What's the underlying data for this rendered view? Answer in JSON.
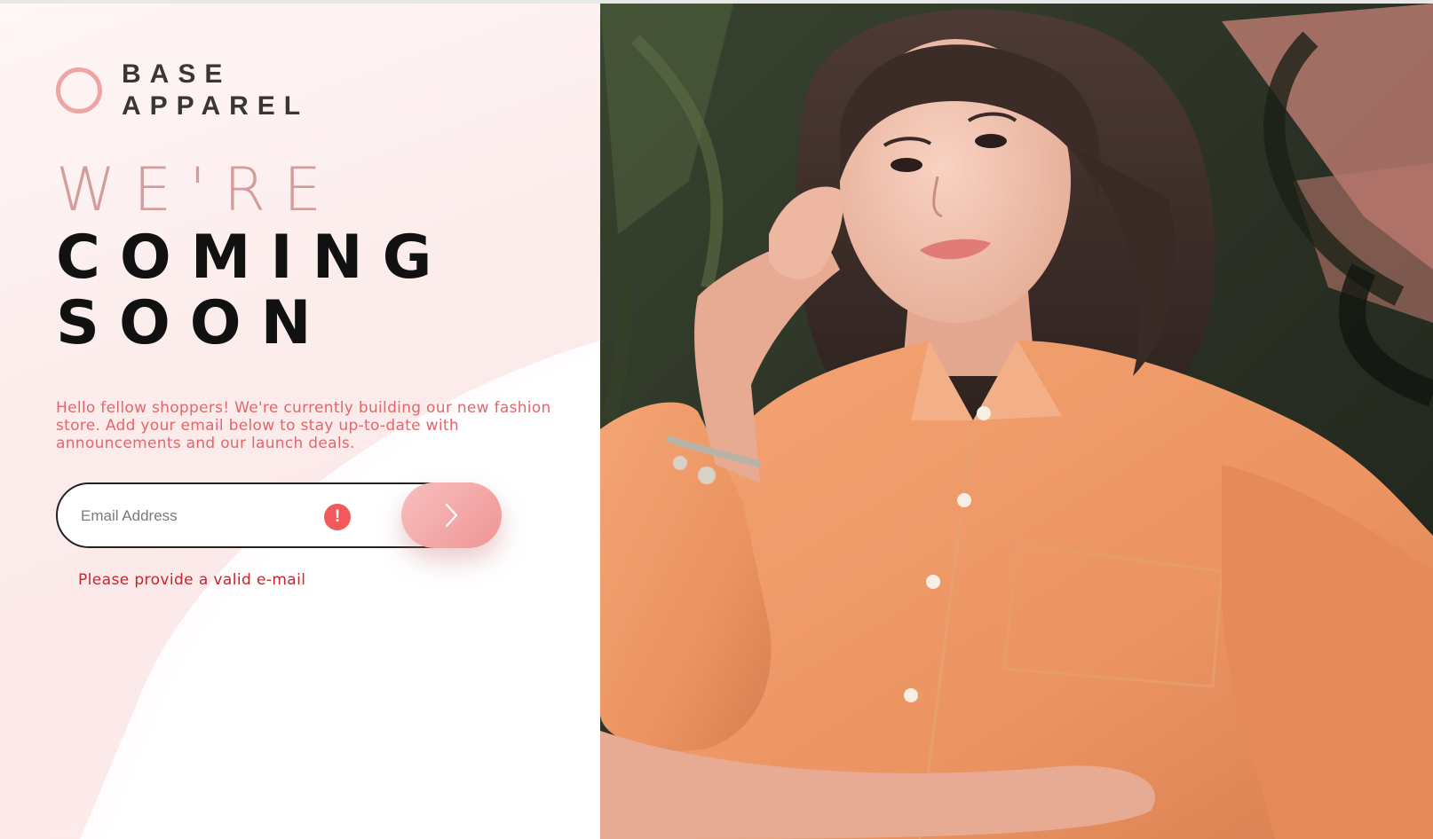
{
  "brand": {
    "name_line1": "BASE",
    "name_line2": "APPAREL",
    "logo_icon": "ring-logo-icon"
  },
  "headline": {
    "line1": "WE'RE",
    "line2": "COMING",
    "line3": "SOON"
  },
  "intro": "Hello fellow shoppers! We're currently building our new fashion store. Add your email below to stay up-to-date with announcements and our launch deals.",
  "form": {
    "email_value": "",
    "email_placeholder": "Email Address",
    "error_icon": "!",
    "submit_icon": "chevron-right-icon",
    "error_message": "Please provide a valid e-mail"
  },
  "hero": {
    "image": "woman-in-peach-shirt-photo"
  },
  "colors": {
    "accent": "#ef9595",
    "headline_light": "#d59c9c",
    "headline_dark": "#111111",
    "intro_text": "#e0686c",
    "error": "#f2595b",
    "error_text": "#c4262e"
  }
}
